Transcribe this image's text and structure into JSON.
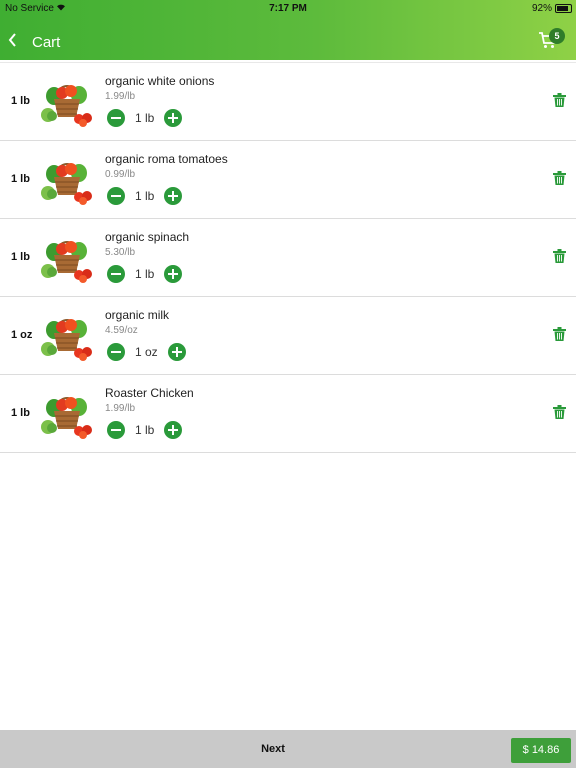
{
  "status_bar": {
    "carrier": "No Service",
    "time": "7:17 PM",
    "battery": "92%"
  },
  "nav": {
    "title": "Cart",
    "cart_count": "5"
  },
  "items": [
    {
      "qty_label": "1 lb",
      "name": "organic white onions",
      "price": "1.99/lb",
      "stepper_value": "1 lb"
    },
    {
      "qty_label": "1 lb",
      "name": "organic roma tomatoes",
      "price": "0.99/lb",
      "stepper_value": "1 lb"
    },
    {
      "qty_label": "1 lb",
      "name": "organic spinach",
      "price": "5.30/lb",
      "stepper_value": "1 lb"
    },
    {
      "qty_label": "1 oz",
      "name": "organic milk",
      "price": "4.59/oz",
      "stepper_value": "1 oz"
    },
    {
      "qty_label": "1 lb",
      "name": "Roaster Chicken",
      "price": "1.99/lb",
      "stepper_value": "1 lb"
    }
  ],
  "footer": {
    "next_label": "Next",
    "total_label": "$ 14.86"
  },
  "colors": {
    "header_start": "#3fae32",
    "header_end": "#8fd146",
    "accent": "#2a9a3a",
    "footer_bg": "#c9c9c9"
  },
  "icons": {
    "back": "chevron-left-icon",
    "cart": "shopping-cart-icon",
    "minus": "minus-circle-icon",
    "plus": "plus-circle-icon",
    "delete": "trash-icon",
    "thumbnail": "vegetable-basket-image"
  }
}
